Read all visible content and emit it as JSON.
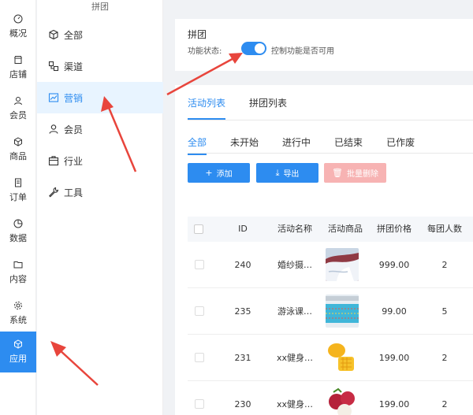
{
  "rail": {
    "items": [
      {
        "label": "概况",
        "icon": "dashboard-icon"
      },
      {
        "label": "店铺",
        "icon": "store-icon"
      },
      {
        "label": "会员",
        "icon": "member-icon"
      },
      {
        "label": "商品",
        "icon": "box-icon"
      },
      {
        "label": "订单",
        "icon": "order-icon"
      },
      {
        "label": "数据",
        "icon": "chart-icon"
      },
      {
        "label": "内容",
        "icon": "folder-icon"
      },
      {
        "label": "系统",
        "icon": "gear-icon"
      },
      {
        "label": "应用",
        "icon": "cube-icon"
      }
    ],
    "active_index": 8
  },
  "subnav": {
    "title": "拼团",
    "items": [
      {
        "label": "全部",
        "icon": "cube-icon"
      },
      {
        "label": "渠道",
        "icon": "channel-icon"
      },
      {
        "label": "营销",
        "icon": "marketing-chart-icon"
      },
      {
        "label": "会员",
        "icon": "member-icon"
      },
      {
        "label": "行业",
        "icon": "briefcase-icon"
      },
      {
        "label": "工具",
        "icon": "wrench-icon"
      }
    ],
    "active_index": 2
  },
  "settings": {
    "title": "拼团",
    "status_label": "功能状态:",
    "switch_on": true,
    "hint": "控制功能是否可用"
  },
  "tabs": {
    "items": [
      "活动列表",
      "拼团列表"
    ],
    "active_index": 0
  },
  "status_tabs": {
    "items": [
      "全部",
      "未开始",
      "进行中",
      "已结束",
      "已作废"
    ],
    "active_index": 0
  },
  "buttons": {
    "add": "添加",
    "export": "导出",
    "batch_delete": "批量删除"
  },
  "table": {
    "columns": [
      "ID",
      "活动名称",
      "活动商品",
      "拼团价格",
      "每团人数"
    ],
    "rows": [
      {
        "id": "240",
        "name": "婚纱摄…",
        "image": "wedding-photo",
        "price": "999.00",
        "group_size": "2"
      },
      {
        "id": "235",
        "name": "游泳课…",
        "image": "swimming-pool",
        "price": "99.00",
        "group_size": "5"
      },
      {
        "id": "231",
        "name": "xx健身…",
        "image": "mango",
        "price": "199.00",
        "group_size": "2"
      },
      {
        "id": "230",
        "name": "xx健身…",
        "image": "lychee",
        "price": "199.00",
        "group_size": "2"
      }
    ]
  },
  "colors": {
    "accent": "#2d8cf0",
    "danger_light": "#f7b3b3",
    "arrow": "#e8453c"
  }
}
